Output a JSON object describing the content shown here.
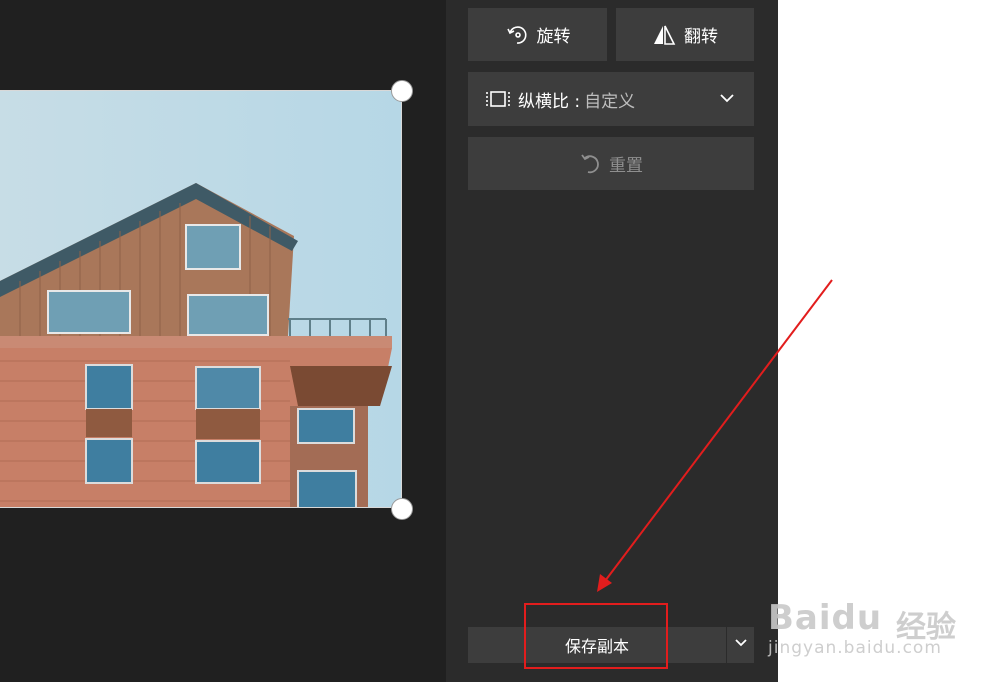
{
  "toolbar": {
    "rotate_label": "旋转",
    "flip_label": "翻转",
    "aspect_label": "纵横比 :",
    "aspect_value": "自定义",
    "reset_label": "重置"
  },
  "save": {
    "label": "保存副本"
  },
  "watermark": {
    "logo": "Baidu",
    "cn": "经验",
    "url": "jingyan.baidu.com"
  },
  "colors": {
    "annotation": "#e21d1d",
    "panel_bg": "#2b2b2b",
    "button_bg": "#3d3d3d"
  },
  "icons": [
    "rotate-icon",
    "flip-icon",
    "aspect-ratio-icon",
    "chevron-down-icon",
    "undo-icon"
  ]
}
